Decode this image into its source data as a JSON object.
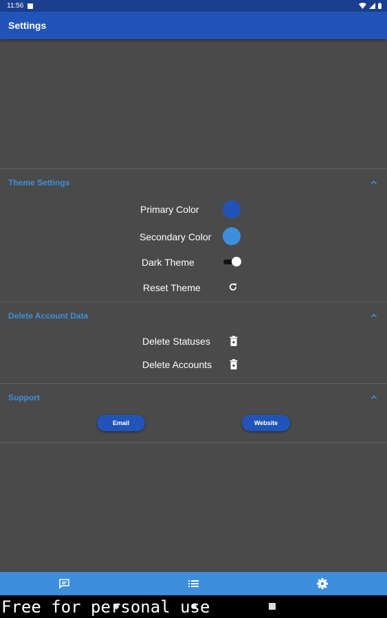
{
  "status_bar": {
    "time": "11:56"
  },
  "app_bar": {
    "title": "Settings"
  },
  "sections": {
    "theme": {
      "title": "Theme Settings",
      "primary_color_label": "Primary Color",
      "primary_color": "#2154b8",
      "secondary_color_label": "Secondary Color",
      "secondary_color": "#3d8fdc",
      "dark_theme_label": "Dark Theme",
      "dark_theme_enabled": true,
      "reset_theme_label": "Reset Theme"
    },
    "delete": {
      "title": "Delete Account Data",
      "statuses_label": "Delete Statuses",
      "accounts_label": "Delete Accounts"
    },
    "support": {
      "title": "Support",
      "email_label": "Email",
      "website_label": "Website"
    }
  },
  "bottom_nav": {
    "items": [
      {
        "icon": "chat-icon"
      },
      {
        "icon": "list-icon"
      },
      {
        "icon": "gear-icon",
        "active": true
      }
    ]
  },
  "watermark": "Free for personal use",
  "colors": {
    "accent": "#3d8fdc",
    "primary": "#2154b8",
    "background": "#4a4a4a"
  }
}
